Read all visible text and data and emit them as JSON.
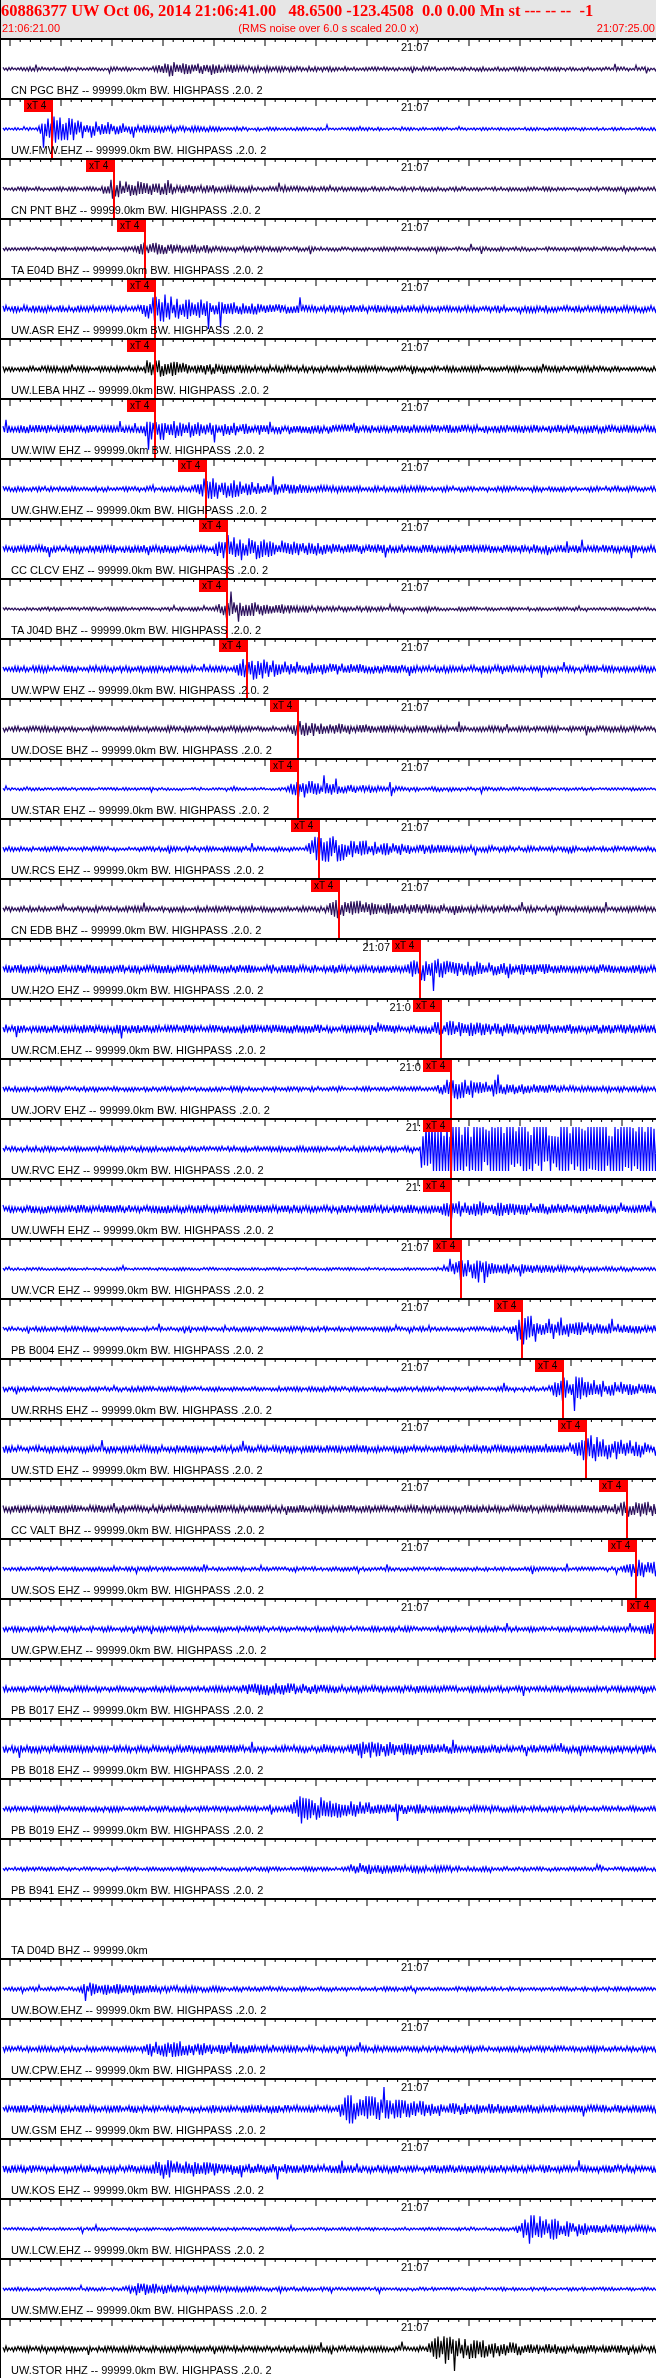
{
  "header": {
    "title": "60886377 UW Oct 06, 2014 21:06:41.00   48.6500 -123.4508  0.0 0.00 Mn st --- -- --  -1",
    "start_time": "21:06:21.00",
    "note": "(RMS noise over 6.0 s scaled 20.0 x)",
    "end_time": "21:07:25.00"
  },
  "traces": [
    {
      "label": "CN PGC BHZ -- 99999.0km BW. HIGHPASS .2.0. 2",
      "color": "#2a0f5c",
      "time_mark": "21:07",
      "has_data": true
    },
    {
      "label": "UW.FMW.EHZ -- 99999.0km BW. HIGHPASS .2.0. 2",
      "color": "#0000ff",
      "time_mark": "21:07",
      "pick": "xT 4",
      "has_data": true
    },
    {
      "label": "CN PNT BHZ -- 99999.0km BW. HIGHPASS .2.0. 2",
      "color": "#2a0f5c",
      "time_mark": "21:07",
      "pick": "xT 4",
      "has_data": true
    },
    {
      "label": "TA E04D BHZ -- 99999.0km BW. HIGHPASS .2.0. 2",
      "color": "#2a0f5c",
      "time_mark": "21:07",
      "pick": "xT 4",
      "has_data": true
    },
    {
      "label": "UW.ASR EHZ -- 99999.0km BW. HIGHPASS .2.0. 2",
      "color": "#0000ff",
      "time_mark": "21:07",
      "pick": "xT 4",
      "has_data": true
    },
    {
      "label": "UW.LEBA HHZ -- 99999.0km BW. HIGHPASS .2.0. 2",
      "color": "#000000",
      "time_mark": "21:07",
      "pick": "xT 4",
      "has_data": true
    },
    {
      "label": "UW.WIW EHZ -- 99999.0km BW. HIGHPASS .2.0. 2",
      "color": "#0000ff",
      "time_mark": "21:07",
      "pick": "xT 4",
      "has_data": true
    },
    {
      "label": "UW.GHW.EHZ -- 99999.0km BW. HIGHPASS .2.0. 2",
      "color": "#0000ff",
      "time_mark": "21:07",
      "pick": "xT 4",
      "has_data": true
    },
    {
      "label": "CC CLCV EHZ -- 99999.0km BW. HIGHPASS .2.0. 2",
      "color": "#0000ff",
      "time_mark": "21:07",
      "pick": "xT 4",
      "has_data": true
    },
    {
      "label": "TA J04D BHZ -- 99999.0km BW. HIGHPASS .2.0. 2",
      "color": "#2a0f5c",
      "time_mark": "21:07",
      "pick": "xT 4",
      "has_data": true
    },
    {
      "label": "UW.WPW EHZ -- 99999.0km BW. HIGHPASS .2.0. 2",
      "color": "#0000ff",
      "time_mark": "21:07",
      "pick": "xT 4",
      "has_data": true
    },
    {
      "label": "UW.DOSE BHZ -- 99999.0km BW. HIGHPASS .2.0. 2",
      "color": "#2a0f5c",
      "time_mark": "21:07",
      "pick": "xT 4",
      "has_data": true
    },
    {
      "label": "UW.STAR EHZ -- 99999.0km BW. HIGHPASS .2.0. 2",
      "color": "#0000ff",
      "time_mark": "21:07",
      "pick": "xT 4",
      "has_data": true
    },
    {
      "label": "UW.RCS EHZ -- 99999.0km BW. HIGHPASS .2.0. 2",
      "color": "#0000ff",
      "time_mark": "21:07",
      "pick": "xT 4",
      "has_data": true
    },
    {
      "label": "CN EDB BHZ -- 99999.0km BW. HIGHPASS .2.0. 2",
      "color": "#2a0f5c",
      "time_mark": "21:07",
      "pick": "xT 4",
      "has_data": true
    },
    {
      "label": "UW.H2O EHZ -- 99999.0km BW. HIGHPASS .2.0. 2",
      "color": "#0000ff",
      "time_mark": "21:07",
      "pick": "xT 4",
      "has_data": true
    },
    {
      "label": "UW.RCM.EHZ -- 99999.0km BW. HIGHPASS .2.0. 2",
      "color": "#0000ff",
      "time_mark": "21:0",
      "pick": "xT 4",
      "has_data": true
    },
    {
      "label": "UW.JORV EHZ -- 99999.0km BW. HIGHPASS .2.0. 2",
      "color": "#0000ff",
      "time_mark": "21:0",
      "pick": "xT 4",
      "has_data": true
    },
    {
      "label": "UW.RVC EHZ -- 99999.0km BW. HIGHPASS .2.0. 2",
      "color": "#0000ff",
      "time_mark": "21:",
      "pick": "xT 4",
      "has_data": true
    },
    {
      "label": "UW.UWFH EHZ -- 99999.0km BW. HIGHPASS .2.0. 2",
      "color": "#0000ff",
      "time_mark": "21:",
      "pick": "xT 4",
      "has_data": true
    },
    {
      "label": "UW.VCR EHZ -- 99999.0km BW. HIGHPASS .2.0. 2",
      "color": "#0000ff",
      "time_mark": "21:07",
      "pick": "xT 4",
      "has_data": true
    },
    {
      "label": "PB B004 EHZ -- 99999.0km BW. HIGHPASS .2.0. 2",
      "color": "#0000ff",
      "time_mark": "21:07",
      "pick": "xT 4",
      "has_data": true
    },
    {
      "label": "UW.RRHS EHZ -- 99999.0km BW. HIGHPASS .2.0. 2",
      "color": "#0000ff",
      "time_mark": "21:07",
      "pick": "xT 4",
      "has_data": true
    },
    {
      "label": "UW.STD EHZ -- 99999.0km BW. HIGHPASS .2.0. 2",
      "color": "#0000ff",
      "time_mark": "21:07",
      "pick": "xT 4",
      "has_data": true
    },
    {
      "label": "CC VALT BHZ -- 99999.0km BW. HIGHPASS .2.0. 2",
      "color": "#2a0f5c",
      "time_mark": "21:07",
      "pick": "xT 4",
      "has_data": true
    },
    {
      "label": "UW.SOS EHZ -- 99999.0km BW. HIGHPASS .2.0. 2",
      "color": "#0000ff",
      "time_mark": "21:07",
      "pick": "xT 4",
      "has_data": true
    },
    {
      "label": "UW.GPW.EHZ -- 99999.0km BW. HIGHPASS .2.0. 2",
      "color": "#0000ff",
      "time_mark": "21:07",
      "pick": "xT 4",
      "has_data": true
    },
    {
      "label": "PB B017 EHZ -- 99999.0km BW. HIGHPASS .2.0. 2",
      "color": "#0000ff",
      "has_data": true
    },
    {
      "label": "PB B018 EHZ -- 99999.0km BW. HIGHPASS .2.0. 2",
      "color": "#0000ff",
      "has_data": true
    },
    {
      "label": "PB B019 EHZ -- 99999.0km BW. HIGHPASS .2.0. 2",
      "color": "#0000ff",
      "has_data": true
    },
    {
      "label": "PB B941 EHZ -- 99999.0km BW. HIGHPASS .2.0. 2",
      "color": "#0000ff",
      "has_data": true
    },
    {
      "label": "TA D04D BHZ -- 99999.0km",
      "has_data": false
    },
    {
      "label": "UW.BOW.EHZ -- 99999.0km BW. HIGHPASS .2.0. 2",
      "color": "#0000ff",
      "time_mark": "21:07",
      "has_data": true
    },
    {
      "label": "UW.CPW.EHZ -- 99999.0km BW. HIGHPASS .2.0. 2",
      "color": "#0000ff",
      "time_mark": "21:07",
      "has_data": true
    },
    {
      "label": "UW.GSM EHZ -- 99999.0km BW. HIGHPASS .2.0. 2",
      "color": "#0000ff",
      "time_mark": "21:07",
      "has_data": true
    },
    {
      "label": "UW.KOS EHZ -- 99999.0km BW. HIGHPASS .2.0. 2",
      "color": "#0000ff",
      "time_mark": "21:07",
      "has_data": true
    },
    {
      "label": "UW.LCW.EHZ -- 99999.0km BW. HIGHPASS .2.0. 2",
      "color": "#0000ff",
      "time_mark": "21:07",
      "has_data": true
    },
    {
      "label": "UW.SMW.EHZ -- 99999.0km BW. HIGHPASS .2.0. 2",
      "color": "#0000ff",
      "time_mark": "21:07",
      "has_data": true
    },
    {
      "label": "UW.STOR HHZ -- 99999.0km BW. HIGHPASS .2.0. 2",
      "color": "#000000",
      "time_mark": "21:07",
      "has_data": true
    }
  ]
}
